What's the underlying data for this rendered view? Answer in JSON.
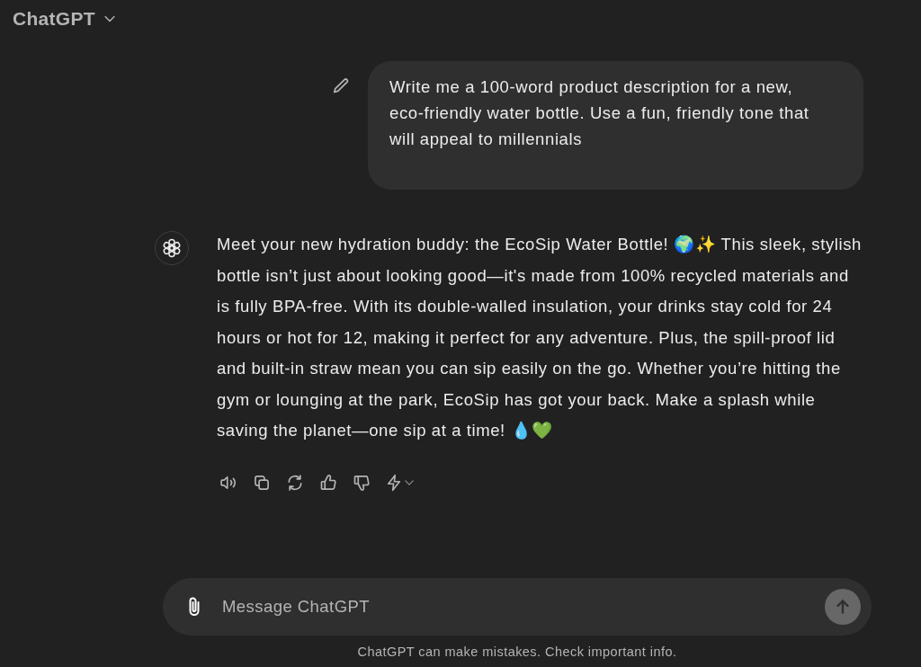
{
  "header": {
    "title": "ChatGPT"
  },
  "messages": [
    {
      "kind": "user",
      "text": "Write me a 100-word product description for a new, eco-friendly water bottle. Use a fun, friendly tone that will appeal to millennials"
    },
    {
      "kind": "assistant",
      "text": "Meet your new hydration buddy: the EcoSip Water Bottle! 🌍✨ This sleek, stylish bottle isn’t just about looking good—it's made from 100% recycled materials and is fully BPA-free. With its double-walled insulation, your drinks stay cold for 24 hours or hot for 12, making it perfect for any adventure. Plus, the spill-proof lid and built-in straw mean you can sip easily on the go. Whether you’re hitting the gym or lounging at the park, EcoSip has got your back. Make a splash while saving the planet—one sip at a time! 💧💚"
    }
  ],
  "composer": {
    "placeholder": "Message ChatGPT"
  },
  "footer": {
    "disclaimer": "ChatGPT can make mistakes. Check important info."
  }
}
